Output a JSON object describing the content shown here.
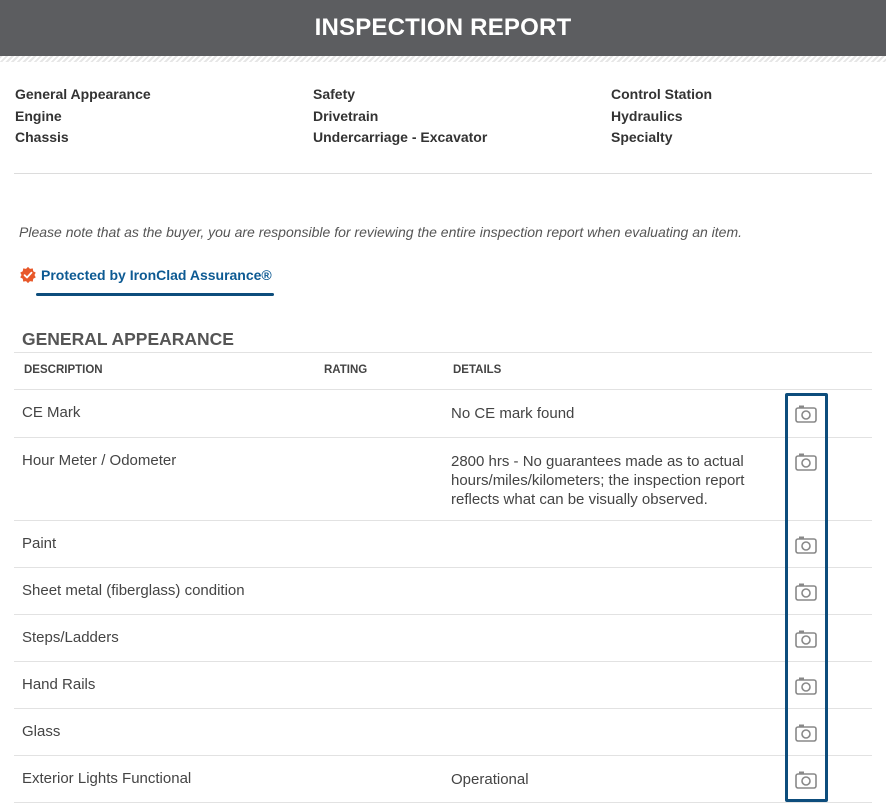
{
  "header": {
    "title": "INSPECTION REPORT"
  },
  "sections": {
    "col1": [
      "General Appearance",
      "Engine",
      "Chassis"
    ],
    "col2": [
      "Safety",
      "Drivetrain",
      "Undercarriage - Excavator"
    ],
    "col3": [
      "Control Station",
      "Hydraulics",
      "Specialty"
    ]
  },
  "note": "Please note that as the buyer, you are responsible for reviewing the entire inspection report when evaluating an item.",
  "assurance": {
    "label": "Protected by IronClad Assurance®"
  },
  "general": {
    "title": "GENERAL APPEARANCE",
    "columns": {
      "description": "DESCRIPTION",
      "rating": "RATING",
      "details": "DETAILS"
    },
    "rows": [
      {
        "description": "CE Mark",
        "details": "No CE mark found"
      },
      {
        "description": "Hour Meter / Odometer",
        "details": "2800 hrs - No guarantees made as to actual hours/miles/kilometers; the inspection report reflects what can be visually observed."
      },
      {
        "description": "Paint",
        "details": ""
      },
      {
        "description": "Sheet metal (fiberglass) condition",
        "details": ""
      },
      {
        "description": "Steps/Ladders",
        "details": ""
      },
      {
        "description": "Hand Rails",
        "details": ""
      },
      {
        "description": "Glass",
        "details": ""
      },
      {
        "description": "Exterior Lights Functional",
        "details": "Operational"
      }
    ]
  },
  "icons": {
    "row_action": "camera-icon",
    "badge": "shield-badge-icon"
  },
  "colors": {
    "header_bg": "#5c5d60",
    "accent": "#0d4d7c",
    "badge": "#e8582a"
  }
}
